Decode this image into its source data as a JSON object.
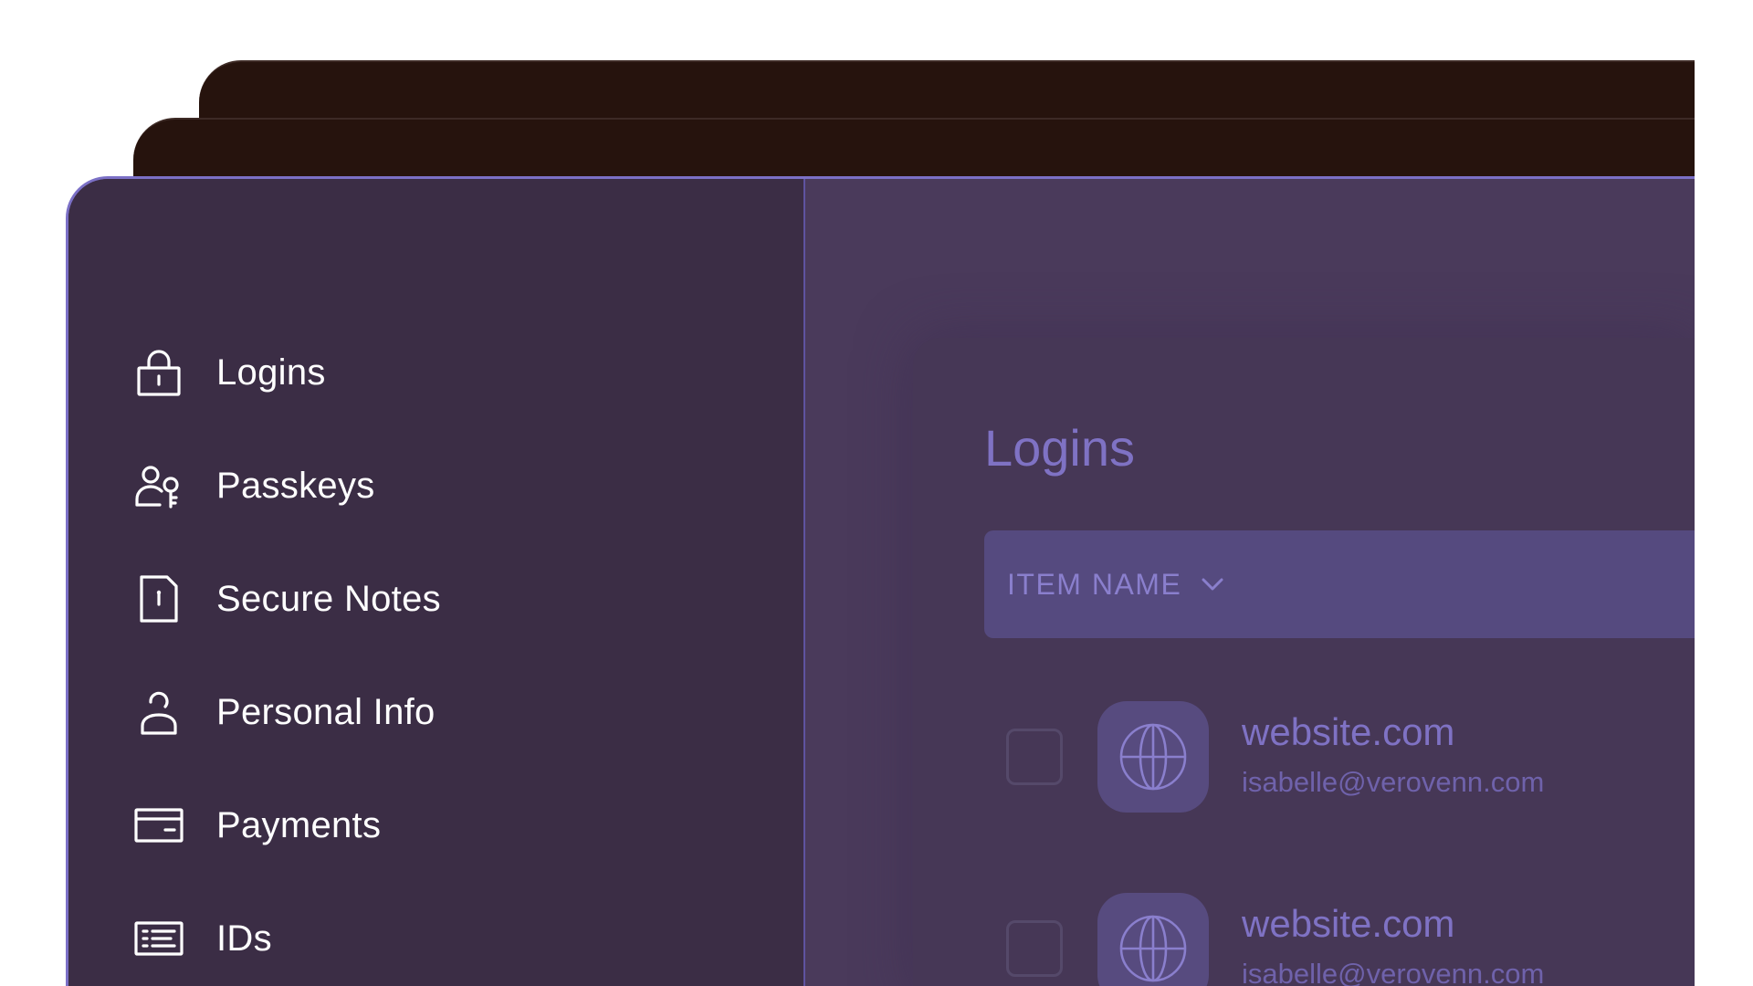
{
  "sidebar": {
    "items": [
      {
        "label": "Logins",
        "icon": "lock-icon"
      },
      {
        "label": "Passkeys",
        "icon": "passkey-icon"
      },
      {
        "label": "Secure Notes",
        "icon": "note-icon"
      },
      {
        "label": "Personal Info",
        "icon": "person-icon"
      },
      {
        "label": "Payments",
        "icon": "credit-card-icon"
      },
      {
        "label": "IDs",
        "icon": "id-card-icon"
      }
    ]
  },
  "main": {
    "title": "Logins",
    "column_header": "ITEM NAME",
    "rows": [
      {
        "name": "website.com",
        "username": "isabelle@verovenn.com",
        "icon": "globe-icon"
      },
      {
        "name": "website.com",
        "username": "isabelle@verovenn.com",
        "icon": "globe-icon"
      }
    ]
  },
  "colors": {
    "outer_card": "#26130d",
    "sidebar_bg": "#3b2d45",
    "main_bg": "#4a3a5b",
    "accent": "#7b70c6",
    "header_bg": "#554a7f"
  }
}
